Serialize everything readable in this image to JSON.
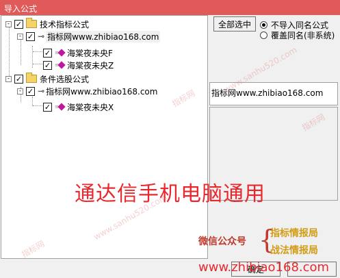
{
  "window": {
    "title": "导入公式"
  },
  "tree": {
    "group1": {
      "label": "技术指标公式",
      "child": {
        "label": "指标网www.zhibiao168.com",
        "items": [
          "海棠夜未央F",
          "海棠夜未央Z"
        ]
      }
    },
    "group2": {
      "label": "条件选股公式",
      "child": {
        "label": "指标网www.zhibiao168.com",
        "items": [
          "海棠夜未央X"
        ]
      }
    }
  },
  "controls": {
    "select_all_label": "全部选中",
    "radio_no_import": "不导入同名公式",
    "radio_overwrite": "覆盖同名(非系统)",
    "selected_radio": "no_import"
  },
  "info": {
    "source_label": "指标网www.zhibiao168.com"
  },
  "overlay": {
    "headline": "通达信手机电脑通用",
    "wechat_label": "微信公众号",
    "wechat_name1": "指标情报局",
    "wechat_name2": "战法情报局",
    "url": "www.zhibiao168.com",
    "watermark_site": "www.sanhu520.com",
    "watermark_text": "指标网"
  },
  "buttons": {
    "ok_partial": "确定"
  }
}
